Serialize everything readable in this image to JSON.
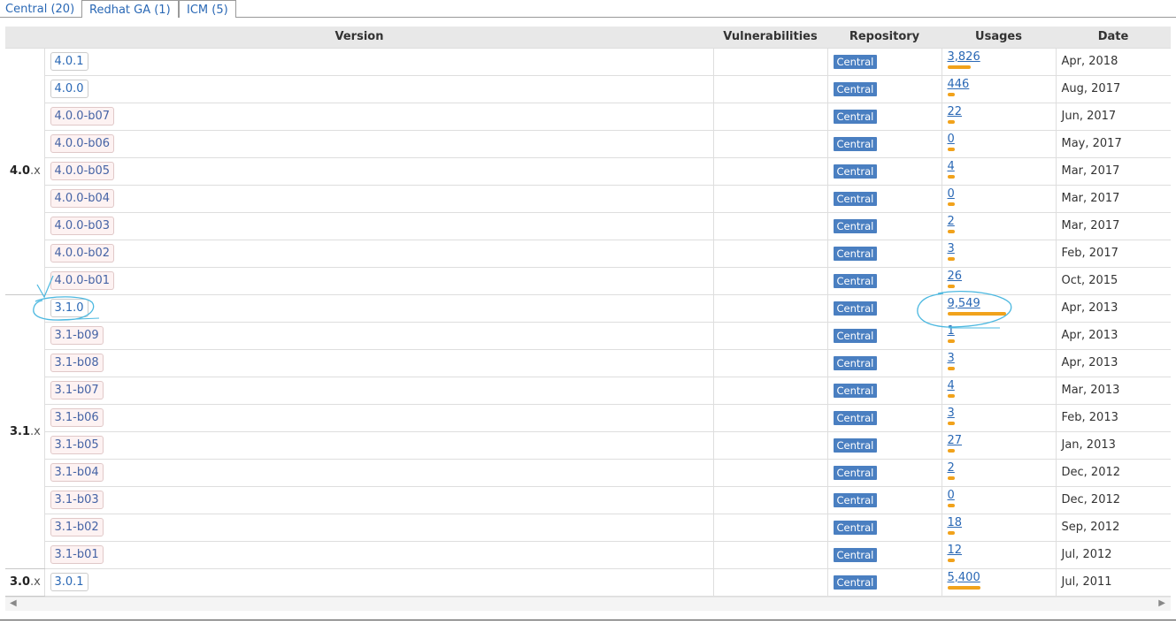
{
  "tabs": [
    {
      "label": "Central (20)",
      "active": true
    },
    {
      "label": "Redhat GA (1)",
      "active": false
    },
    {
      "label": "ICM (5)",
      "active": false
    }
  ],
  "headers": {
    "version": "Version",
    "vulnerabilities": "Vulnerabilities",
    "repository": "Repository",
    "usages": "Usages",
    "date": "Date"
  },
  "colors": {
    "accent": "#2a68b5",
    "badge": "#4a7fc1",
    "usage_bar": "#f1a21b",
    "annotation": "#4cb8e0"
  },
  "groups": [
    {
      "major": "4.0",
      "suffix": ".x",
      "rows": [
        {
          "version": "4.0.1",
          "beta": false,
          "repo": "Central",
          "usages": "3,826",
          "date": "Apr, 2018"
        },
        {
          "version": "4.0.0",
          "beta": false,
          "repo": "Central",
          "usages": "446",
          "date": "Aug, 2017"
        },
        {
          "version": "4.0.0-b07",
          "beta": true,
          "repo": "Central",
          "usages": "22",
          "date": "Jun, 2017"
        },
        {
          "version": "4.0.0-b06",
          "beta": true,
          "repo": "Central",
          "usages": "0",
          "date": "May, 2017"
        },
        {
          "version": "4.0.0-b05",
          "beta": true,
          "repo": "Central",
          "usages": "4",
          "date": "Mar, 2017"
        },
        {
          "version": "4.0.0-b04",
          "beta": true,
          "repo": "Central",
          "usages": "0",
          "date": "Mar, 2017"
        },
        {
          "version": "4.0.0-b03",
          "beta": true,
          "repo": "Central",
          "usages": "2",
          "date": "Mar, 2017"
        },
        {
          "version": "4.0.0-b02",
          "beta": true,
          "repo": "Central",
          "usages": "3",
          "date": "Feb, 2017"
        },
        {
          "version": "4.0.0-b01",
          "beta": true,
          "repo": "Central",
          "usages": "26",
          "date": "Oct, 2015"
        }
      ]
    },
    {
      "major": "3.1",
      "suffix": ".x",
      "rows": [
        {
          "version": "3.1.0",
          "beta": false,
          "repo": "Central",
          "usages": "9,549",
          "date": "Apr, 2013"
        },
        {
          "version": "3.1-b09",
          "beta": true,
          "repo": "Central",
          "usages": "1",
          "date": "Apr, 2013"
        },
        {
          "version": "3.1-b08",
          "beta": true,
          "repo": "Central",
          "usages": "3",
          "date": "Apr, 2013"
        },
        {
          "version": "3.1-b07",
          "beta": true,
          "repo": "Central",
          "usages": "4",
          "date": "Mar, 2013"
        },
        {
          "version": "3.1-b06",
          "beta": true,
          "repo": "Central",
          "usages": "3",
          "date": "Feb, 2013"
        },
        {
          "version": "3.1-b05",
          "beta": true,
          "repo": "Central",
          "usages": "27",
          "date": "Jan, 2013"
        },
        {
          "version": "3.1-b04",
          "beta": true,
          "repo": "Central",
          "usages": "2",
          "date": "Dec, 2012"
        },
        {
          "version": "3.1-b03",
          "beta": true,
          "repo": "Central",
          "usages": "0",
          "date": "Dec, 2012"
        },
        {
          "version": "3.1-b02",
          "beta": true,
          "repo": "Central",
          "usages": "18",
          "date": "Sep, 2012"
        },
        {
          "version": "3.1-b01",
          "beta": true,
          "repo": "Central",
          "usages": "12",
          "date": "Jul, 2012"
        }
      ]
    },
    {
      "major": "3.0",
      "suffix": ".x",
      "rows": [
        {
          "version": "3.0.1",
          "beta": false,
          "repo": "Central",
          "usages": "5,400",
          "date": "Jul, 2011"
        }
      ]
    }
  ]
}
